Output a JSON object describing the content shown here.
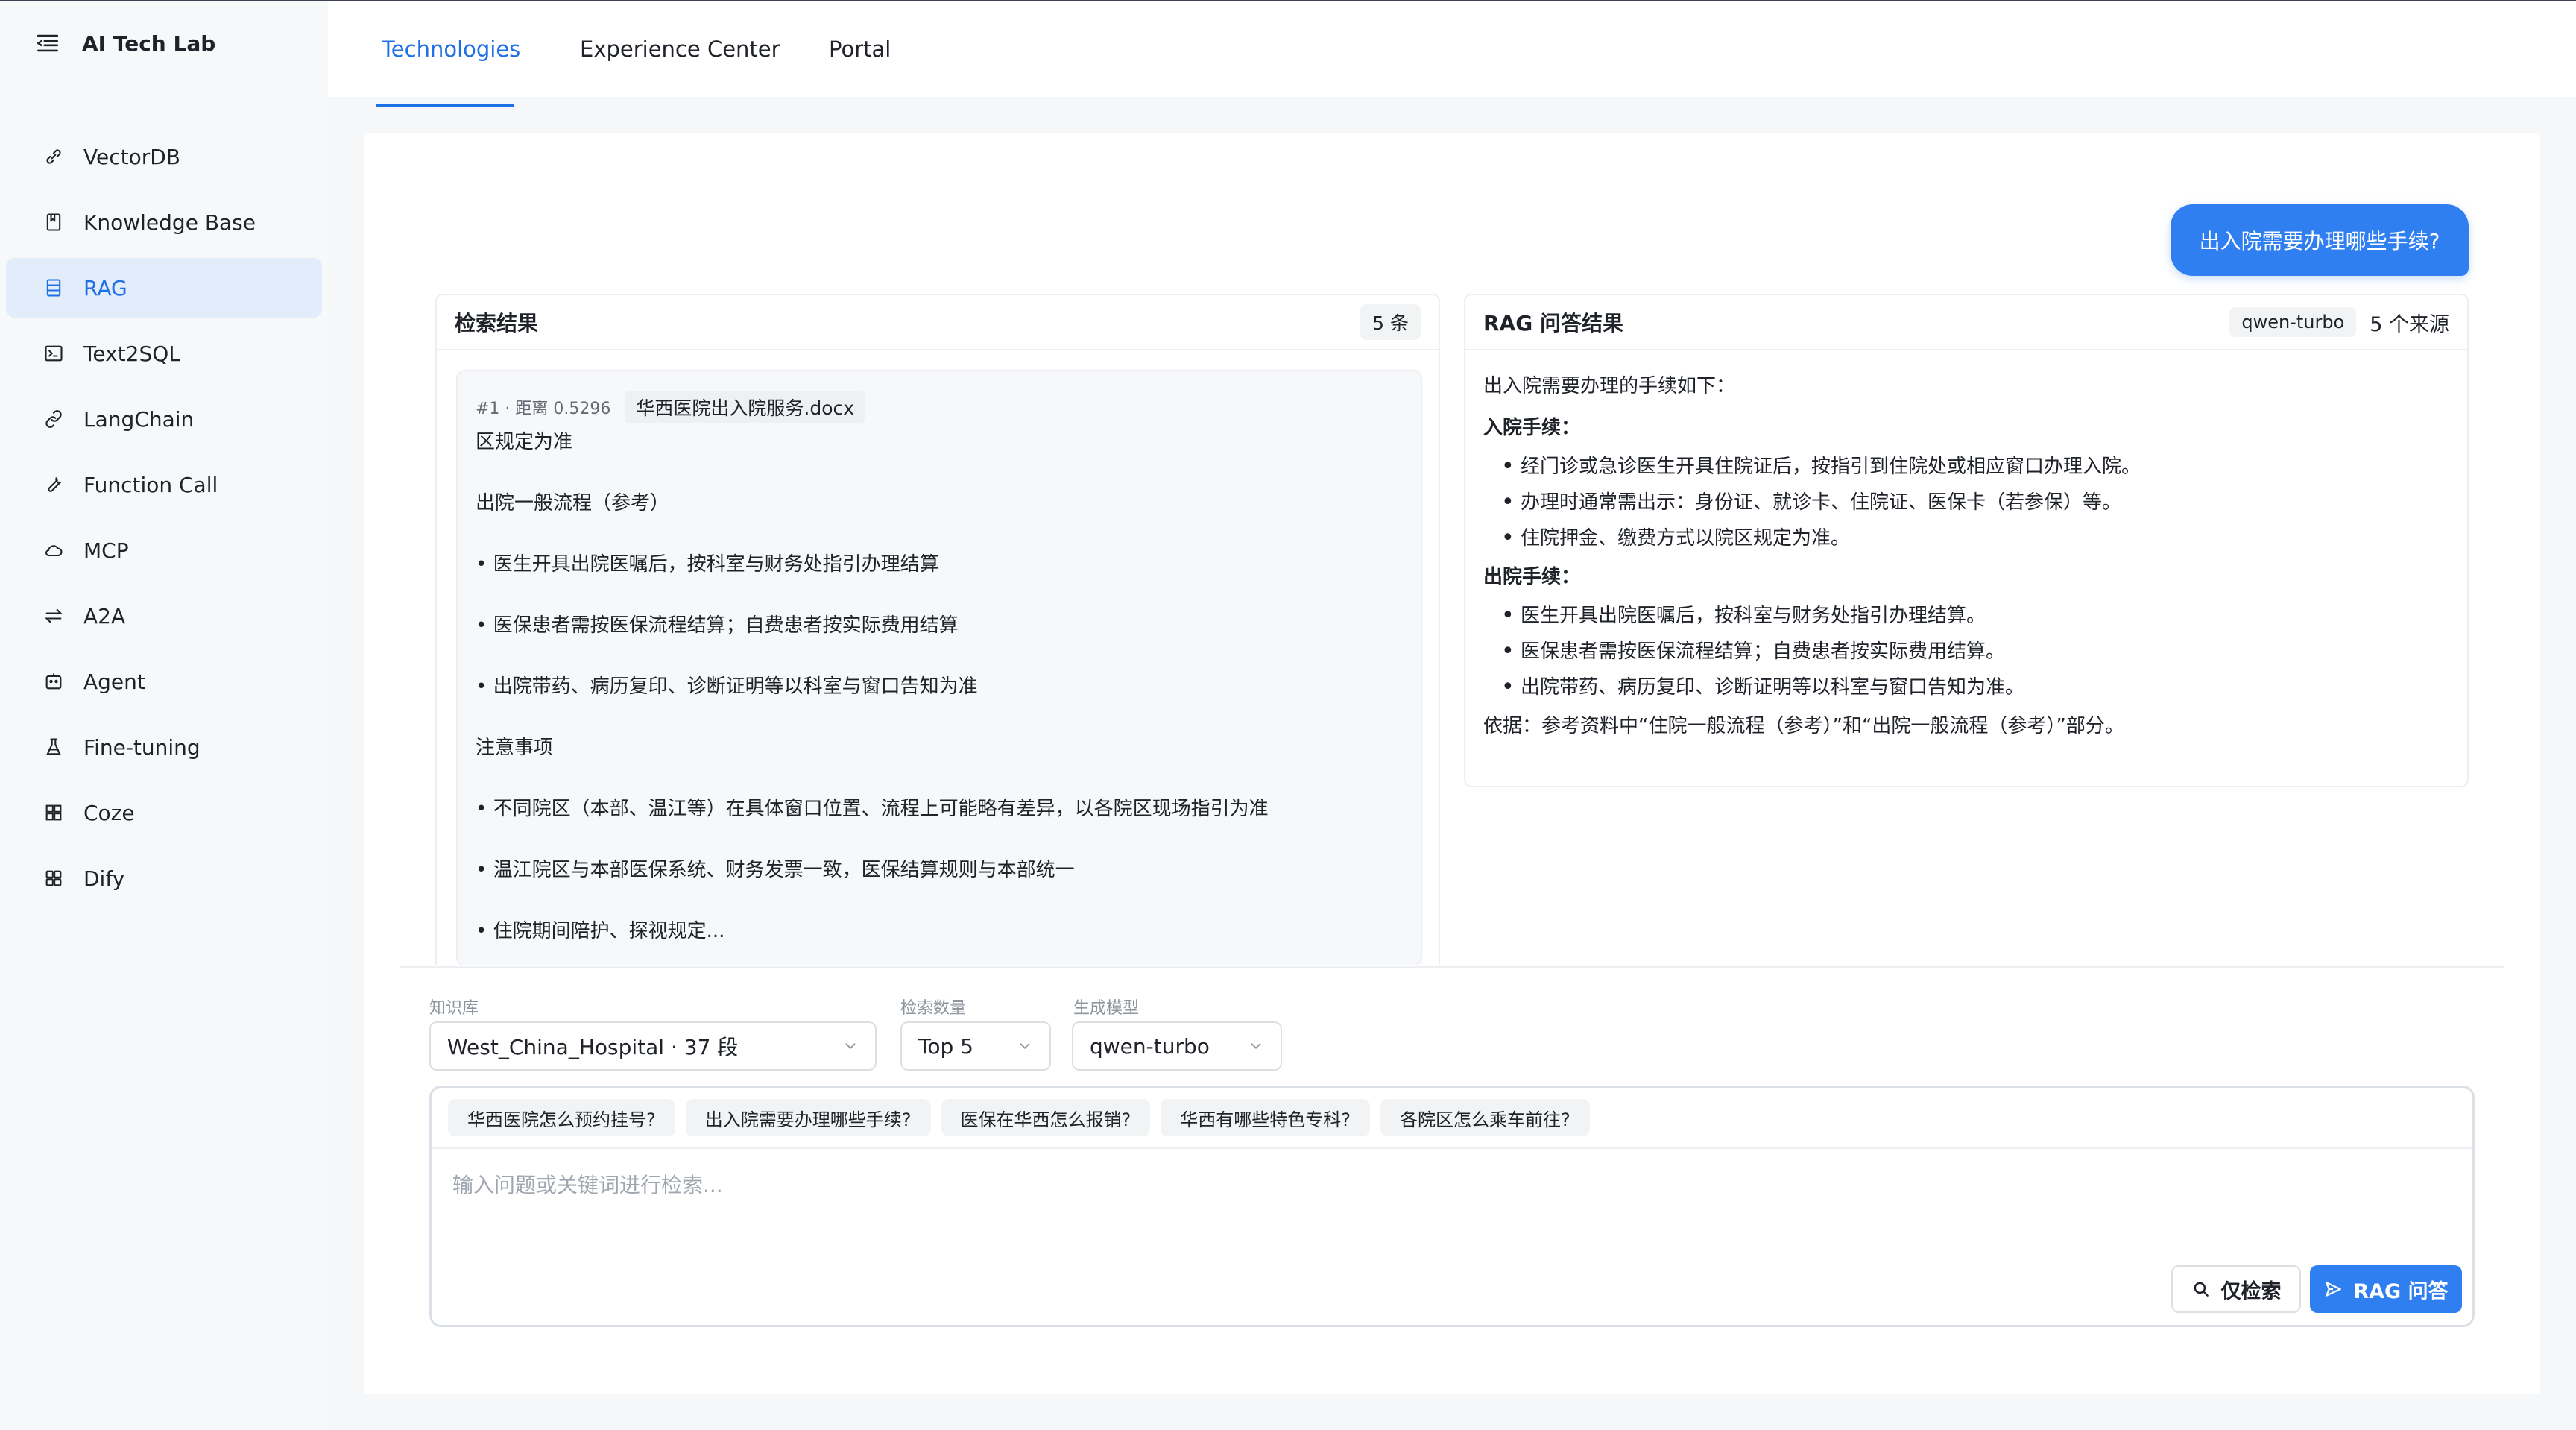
{
  "app": {
    "title": "AI Tech Lab"
  },
  "sidebar": {
    "items": [
      {
        "label": "VectorDB",
        "icon": "link-icon"
      },
      {
        "label": "Knowledge Base",
        "icon": "book-icon"
      },
      {
        "label": "RAG",
        "icon": "database-icon",
        "active": true
      },
      {
        "label": "Text2SQL",
        "icon": "terminal-icon"
      },
      {
        "label": "LangChain",
        "icon": "chain-icon"
      },
      {
        "label": "Function Call",
        "icon": "tool-icon"
      },
      {
        "label": "MCP",
        "icon": "cloud-icon"
      },
      {
        "label": "A2A",
        "icon": "swap-icon"
      },
      {
        "label": "Agent",
        "icon": "robot-icon"
      },
      {
        "label": "Fine-tuning",
        "icon": "flask-icon"
      },
      {
        "label": "Coze",
        "icon": "grid-icon"
      },
      {
        "label": "Dify",
        "icon": "apps-icon"
      }
    ]
  },
  "tabs": [
    {
      "label": "Technologies",
      "active": true
    },
    {
      "label": "Experience Center"
    },
    {
      "label": "Portal"
    }
  ],
  "chat": {
    "user_question": "出入院需要办理哪些手续?"
  },
  "retrieval": {
    "title": "检索结果",
    "count": "5 条",
    "result": {
      "meta": "#1 · 距离 0.5296",
      "doc": "华西医院出入院服务.docx",
      "lines": [
        "区规定为准",
        "出院一般流程（参考）",
        "• 医生开具出院医嘱后，按科室与财务处指引办理结算",
        "• 医保患者需按医保流程结算；自费患者按实际费用结算",
        "• 出院带药、病历复印、诊断证明等以科室与窗口告知为准",
        "注意事项",
        "• 不同院区（本部、温江等）在具体窗口位置、流程上可能略有差异，以各院区现场指引为准",
        "• 温江院区与本部医保系统、财务发票一致，医保结算规则与本部统一",
        "• 住院期间陪护、探视规定..."
      ]
    }
  },
  "answer": {
    "title": "RAG 问答结果",
    "model": "qwen-turbo",
    "sources": "5 个来源",
    "intro": "出入院需要办理的手续如下：",
    "admission_title": "入院手续：",
    "admission": [
      "经门诊或急诊医生开具住院证后，按指引到住院处或相应窗口办理入院。",
      "办理时通常需出示：身份证、就诊卡、住院证、医保卡（若参保）等。",
      "住院押金、缴费方式以院区规定为准。"
    ],
    "discharge_title": "出院手续：",
    "discharge": [
      "医生开具出院医嘱后，按科室与财务处指引办理结算。",
      "医保患者需按医保流程结算；自费患者按实际费用结算。",
      "出院带药、病历复印、诊断证明等以科室与窗口告知为准。"
    ],
    "basis": "依据：参考资料中“住院一般流程（参考）”和“出院一般流程（参考）”部分。"
  },
  "controls": {
    "kb_label": "知识库",
    "kb_value": "West_China_Hospital · 37 段",
    "topk_label": "检索数量",
    "topk_value": "Top 5",
    "model_label": "生成模型",
    "model_value": "qwen-turbo"
  },
  "suggestions": [
    "华西医院怎么预约挂号?",
    "出入院需要办理哪些手续?",
    "医保在华西怎么报销?",
    "华西有哪些特色专科?",
    "各院区怎么乘车前往?"
  ],
  "input": {
    "placeholder": "输入问题或关键词进行检索...",
    "value": ""
  },
  "buttons": {
    "search_only": "仅检索",
    "rag_answer": "RAG 问答"
  },
  "colors": {
    "accent": "#2f7ff0",
    "active_bg": "#e2ecfb",
    "active_text": "#1f6fe5"
  }
}
